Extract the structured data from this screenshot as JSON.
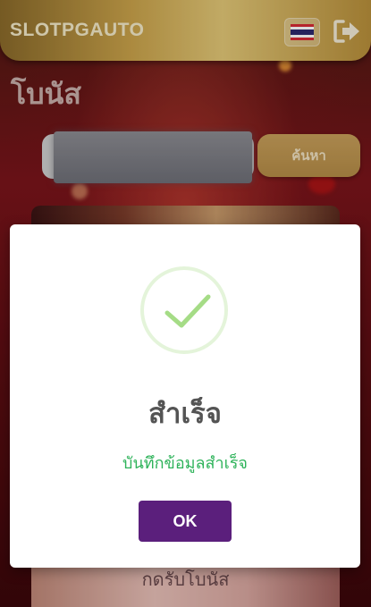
{
  "header": {
    "brand": "SLOTPGAUTO",
    "flag_icon": "thailand-flag-icon",
    "logout_icon": "logout-icon"
  },
  "page": {
    "title": "โบนัส"
  },
  "search": {
    "value": "",
    "button_label": "ค้นหา"
  },
  "promo_card": {
    "claim_label": "กดรับโบนัส"
  },
  "modal": {
    "icon": "success-check-icon",
    "title": "สำเร็จ",
    "message": "บันทึกข้อมูลสำเร็จ",
    "ok_label": "OK"
  },
  "colors": {
    "header_gold": "#c9a24a",
    "success_green": "#2eb35a",
    "check_green": "#a5dc86",
    "ok_purple": "#5b1f7c",
    "background_red": "#7a141a"
  }
}
